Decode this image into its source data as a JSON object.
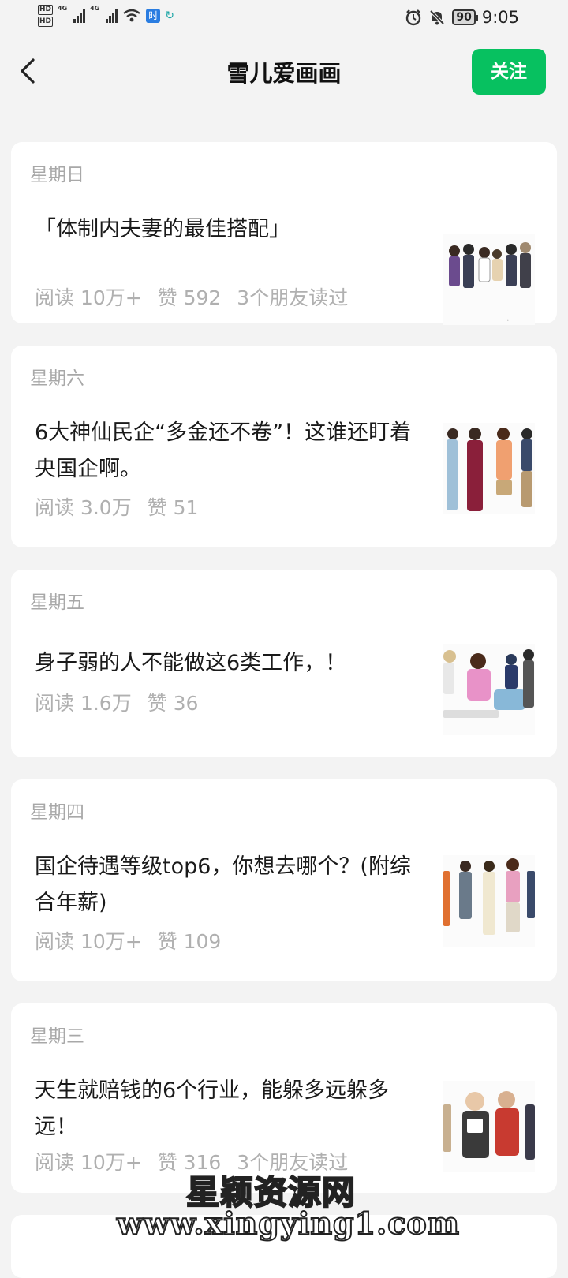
{
  "status_bar": {
    "hd1": "HD",
    "hd2": "HD",
    "net1": "4G",
    "net2": "4G",
    "app_icon_text": "时",
    "battery": "90",
    "time": "9:05",
    "icons": [
      "signal-icon",
      "wifi-icon",
      "sync-icon",
      "alarm-icon",
      "mute-icon",
      "battery-icon"
    ]
  },
  "header": {
    "title": "雪儿爱画画",
    "follow_label": "关注"
  },
  "articles": [
    {
      "day": "星期日",
      "title": "「体制内夫妻的最佳搭配」",
      "reads": "阅读 10万+",
      "likes": "赞 592",
      "friends": "3个朋友读过"
    },
    {
      "day": "星期六",
      "title": "6大神仙民企“多金还不卷”！这谁还盯着央国企啊。",
      "reads": "阅读 3.0万",
      "likes": "赞 51",
      "friends": ""
    },
    {
      "day": "星期五",
      "title": "身子弱的人不能做这6类工作，！",
      "reads": "阅读 1.6万",
      "likes": "赞 36",
      "friends": ""
    },
    {
      "day": "星期四",
      "title": "国企待遇等级top6，你想去哪个？(附综合年薪)",
      "reads": "阅读 10万+",
      "likes": "赞 109",
      "friends": ""
    },
    {
      "day": "星期三",
      "title": "天生就赔钱的6个行业，能躲多远躲多远！",
      "reads": "阅读 10万+",
      "likes": "赞 316",
      "friends": "3个朋友读过"
    }
  ],
  "watermark": {
    "name": "星颖资源网",
    "url": "www.xingying1.com"
  },
  "colors": {
    "accent": "#07c160",
    "background": "#f3f3f3",
    "meta_text": "#b0b0b0"
  }
}
